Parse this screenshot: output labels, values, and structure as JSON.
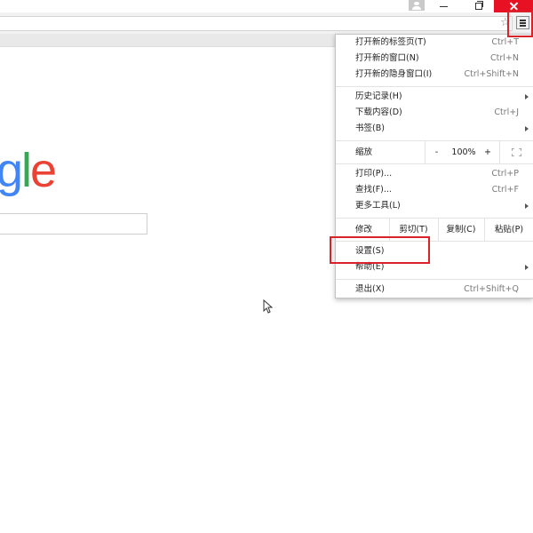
{
  "menu": {
    "items_top": [
      {
        "label": "打开新的标签页(T)",
        "shortcut": "Ctrl+T"
      },
      {
        "label": "打开新的窗口(N)",
        "shortcut": "Ctrl+N"
      },
      {
        "label": "打开新的隐身窗口(I)",
        "shortcut": "Ctrl+Shift+N"
      }
    ],
    "items_history": [
      {
        "label": "历史记录(H)",
        "shortcut": ""
      },
      {
        "label": "下载内容(D)",
        "shortcut": "Ctrl+J"
      },
      {
        "label": "书签(B)",
        "shortcut": ""
      }
    ],
    "zoom": {
      "label": "缩放",
      "minus": "-",
      "value": "100%",
      "plus": "+"
    },
    "items_print": [
      {
        "label": "打印(P)...",
        "shortcut": "Ctrl+P"
      },
      {
        "label": "查找(F)...",
        "shortcut": "Ctrl+F"
      },
      {
        "label": "更多工具(L)",
        "shortcut": ""
      }
    ],
    "edit": {
      "label": "修改",
      "cut": "剪切(T)",
      "copy": "复制(C)",
      "paste": "粘贴(P)"
    },
    "settings": {
      "label": "设置(S)"
    },
    "help": {
      "label": "帮助(E)"
    },
    "exit": {
      "label": "退出(X)",
      "shortcut": "Ctrl+Shift+Q"
    }
  },
  "page": {
    "logo_visible": [
      {
        "ch": "g",
        "color": "#4285f4"
      },
      {
        "ch": "l",
        "color": "#34a853"
      },
      {
        "ch": "e",
        "color": "#ea4335"
      }
    ]
  },
  "icons": [
    "profile-icon",
    "minimize-icon",
    "restore-icon",
    "close-icon",
    "star-icon",
    "menu-icon",
    "fullscreen-icon",
    "submenu-arrow-icon",
    "cursor-icon"
  ],
  "colors": {
    "close_button": "#e81123",
    "annotation": "#d9222a"
  }
}
